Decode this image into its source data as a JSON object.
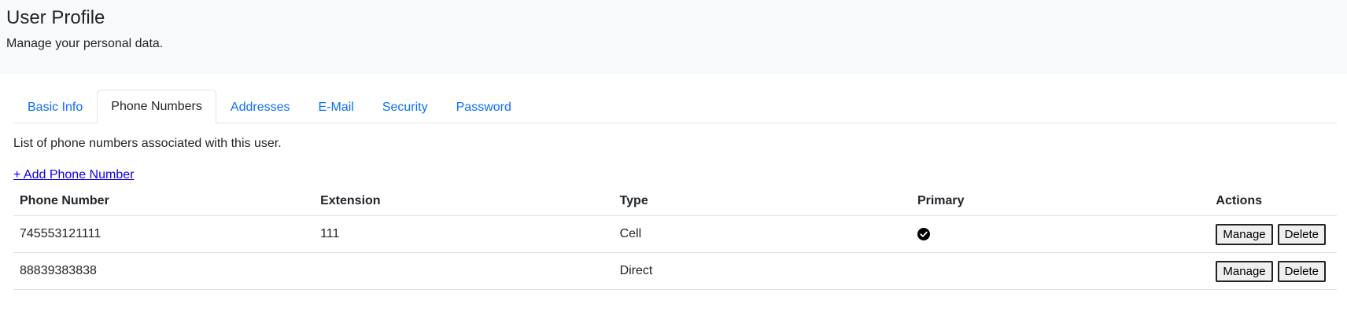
{
  "header": {
    "title": "User Profile",
    "subtitle": "Manage your personal data."
  },
  "tabs": [
    {
      "label": "Basic Info",
      "active": false
    },
    {
      "label": "Phone Numbers",
      "active": true
    },
    {
      "label": "Addresses",
      "active": false
    },
    {
      "label": "E-Mail",
      "active": false
    },
    {
      "label": "Security",
      "active": false
    },
    {
      "label": "Password",
      "active": false
    }
  ],
  "main": {
    "description": "List of phone numbers associated with this user.",
    "add_link": "+ Add Phone Number",
    "table": {
      "headers": [
        "Phone Number",
        "Extension",
        "Type",
        "Primary",
        "Actions"
      ],
      "rows": [
        {
          "phone": "745553121111",
          "extension": "111",
          "type": "Cell",
          "primary": true,
          "manage": "Manage",
          "delete": "Delete"
        },
        {
          "phone": "88839383838",
          "extension": "",
          "type": "Direct",
          "primary": false,
          "manage": "Manage",
          "delete": "Delete"
        }
      ]
    }
  },
  "icons": {
    "primary": "check-circle-icon"
  },
  "colors": {
    "link": "#0d6efd",
    "add_link": "#0d00ee",
    "header_bg": "#f8f9fa"
  }
}
